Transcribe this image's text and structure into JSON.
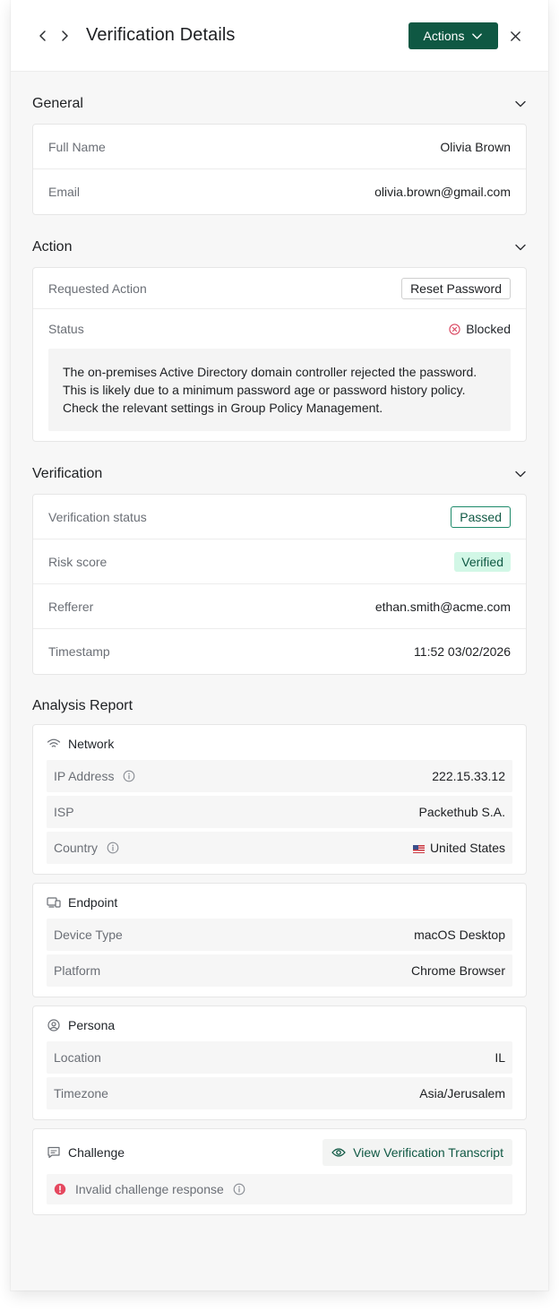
{
  "header": {
    "title": "Verification Details",
    "actions_label": "Actions"
  },
  "general": {
    "title": "General",
    "rows": [
      {
        "label": "Full Name",
        "value": "Olivia Brown"
      },
      {
        "label": "Email",
        "value": "olivia.brown@gmail.com"
      }
    ]
  },
  "action": {
    "title": "Action",
    "requested_label": "Requested Action",
    "requested_value": "Reset Password",
    "status_label": "Status",
    "status_value": "Blocked",
    "message": "The on-premises Active Directory domain controller rejected the password. This is likely due to a minimum password age or password history policy. Check the relevant settings in Group Policy Management."
  },
  "verification": {
    "title": "Verification",
    "status_label": "Verification status",
    "status_value": "Passed",
    "risk_label": "Risk score",
    "risk_value": "Verified",
    "referrer_label": "Refferer",
    "referrer_value": "ethan.smith@acme.com",
    "timestamp_label": "Timestamp",
    "timestamp_value": "11:52 03/02/2026"
  },
  "analysis": {
    "title": "Analysis Report",
    "network": {
      "title": "Network",
      "ip_label": "IP Address",
      "ip_value": "222.15.33.12",
      "isp_label": "ISP",
      "isp_value": "Packethub S.A.",
      "country_label": "Country",
      "country_value": "United States"
    },
    "endpoint": {
      "title": "Endpoint",
      "device_label": "Device Type",
      "device_value": "macOS Desktop",
      "platform_label": "Platform",
      "platform_value": "Chrome Browser"
    },
    "persona": {
      "title": "Persona",
      "location_label": "Location",
      "location_value": "IL",
      "timezone_label": "Timezone",
      "timezone_value": "Asia/Jerusalem"
    },
    "challenge": {
      "title": "Challenge",
      "transcript_label": "View Verification Transcript",
      "error_text": "Invalid challenge response"
    }
  },
  "colors": {
    "brand": "#0f5843",
    "blocked": "#d9455f",
    "verified_bg": "#d2f7e6"
  },
  "icons": [
    "chevron-left-icon",
    "chevron-right-icon",
    "chevron-down-icon",
    "close-icon",
    "x-circle-icon",
    "info-icon",
    "wifi-icon",
    "devices-icon",
    "user-circle-icon",
    "message-icon",
    "eye-icon",
    "alert-icon",
    "us-flag-icon"
  ]
}
